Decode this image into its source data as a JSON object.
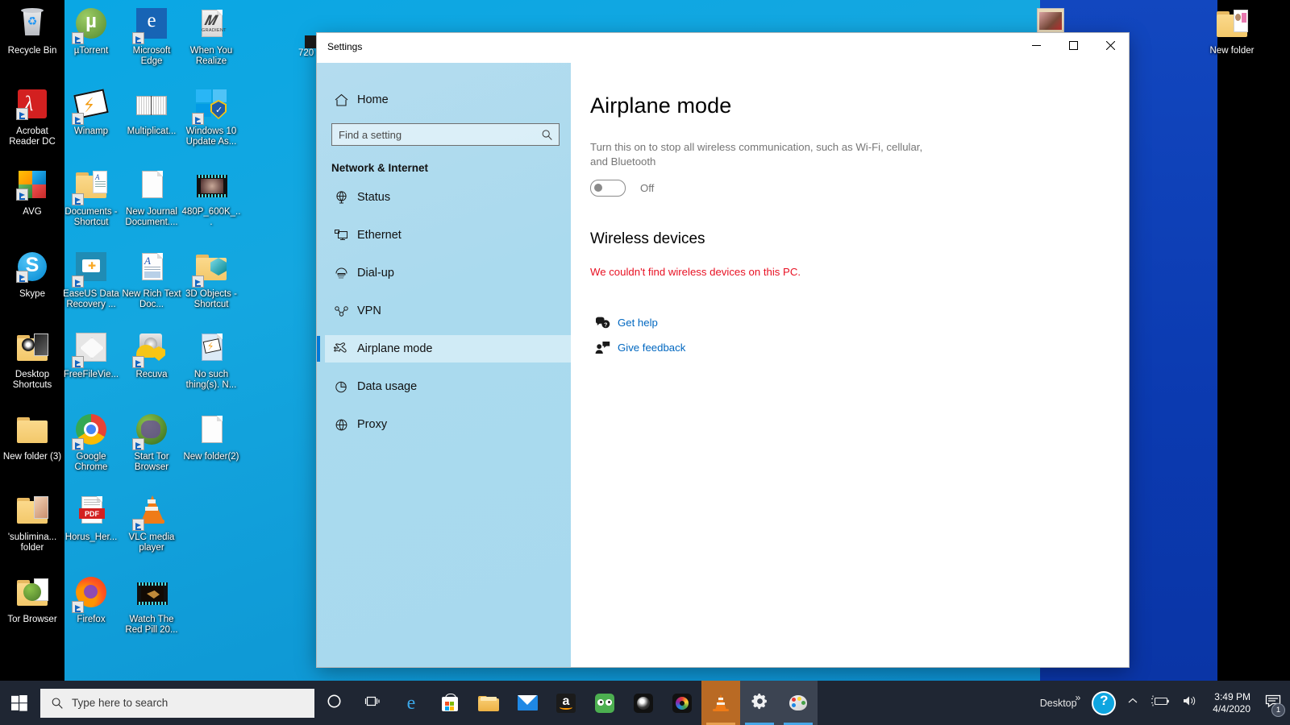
{
  "desktop": {
    "partial_label_720": "720",
    "column_left": [
      {
        "name": "Recycle Bin",
        "icon": "recycle-bin-icon"
      },
      {
        "name": "Acrobat Reader DC",
        "icon": "acrobat-reader-icon"
      },
      {
        "name": "AVG",
        "icon": "avg-icon"
      },
      {
        "name": "Skype",
        "icon": "skype-icon"
      },
      {
        "name": "Desktop Shortcuts",
        "icon": "folder-icon"
      },
      {
        "name": "New folder (3)",
        "icon": "folder-icon"
      },
      {
        "name": "'sublimina... folder",
        "icon": "folder-icon"
      },
      {
        "name": "Tor Browser",
        "icon": "folder-icon"
      }
    ],
    "grid": [
      {
        "name": "µTorrent",
        "icon": "utorrent-icon"
      },
      {
        "name": "Microsoft Edge",
        "icon": "edge-icon"
      },
      {
        "name": "When You Realize",
        "icon": "gradient-file-icon"
      },
      {
        "name": "Winamp",
        "icon": "winamp-icon"
      },
      {
        "name": "Multiplicat...",
        "icon": "image-file-icon"
      },
      {
        "name": "Windows 10 Update As...",
        "icon": "windows-update-icon"
      },
      {
        "name": "Documents - Shortcut",
        "icon": "documents-folder-icon"
      },
      {
        "name": "New Journal Document....",
        "icon": "document-icon"
      },
      {
        "name": "480P_600K_...",
        "icon": "video-file-icon"
      },
      {
        "name": "EaseUS Data Recovery ...",
        "icon": "easeus-icon"
      },
      {
        "name": "New Rich Text Doc...",
        "icon": "rtf-document-icon"
      },
      {
        "name": "3D Objects - Shortcut",
        "icon": "3d-objects-folder-icon"
      },
      {
        "name": "FreeFileVie...",
        "icon": "freefileviewer-icon"
      },
      {
        "name": "Recuva",
        "icon": "recuva-icon"
      },
      {
        "name": "No such thing(s). N...",
        "icon": "winamp-file-icon"
      },
      {
        "name": "Google Chrome",
        "icon": "chrome-icon"
      },
      {
        "name": "Start Tor Browser",
        "icon": "tor-icon"
      },
      {
        "name": "New folder(2)",
        "icon": "document-icon"
      },
      {
        "name": "Horus_Her...",
        "icon": "pdf-file-icon"
      },
      {
        "name": "VLC media player",
        "icon": "vlc-icon"
      },
      {
        "name": "",
        "icon": "none"
      },
      {
        "name": "Firefox",
        "icon": "firefox-icon"
      },
      {
        "name": "Watch The Red Pill 20...",
        "icon": "video-file-icon"
      },
      {
        "name": "",
        "icon": "none"
      }
    ],
    "right": [
      {
        "name": "New folder",
        "icon": "folder-icon"
      }
    ]
  },
  "window": {
    "title": "Settings",
    "controls": {
      "minimize": "minimize-button",
      "maximize": "maximize-button",
      "close": "close-button"
    }
  },
  "sidebar": {
    "home_label": "Home",
    "search": {
      "placeholder": "Find a setting",
      "value": ""
    },
    "category": "Network & Internet",
    "items": [
      {
        "label": "Status",
        "icon": "status-globe-icon",
        "selected": false
      },
      {
        "label": "Ethernet",
        "icon": "ethernet-icon",
        "selected": false
      },
      {
        "label": "Dial-up",
        "icon": "dialup-icon",
        "selected": false
      },
      {
        "label": "VPN",
        "icon": "vpn-icon",
        "selected": false
      },
      {
        "label": "Airplane mode",
        "icon": "airplane-icon",
        "selected": true
      },
      {
        "label": "Data usage",
        "icon": "data-usage-icon",
        "selected": false
      },
      {
        "label": "Proxy",
        "icon": "proxy-globe-icon",
        "selected": false
      }
    ]
  },
  "main": {
    "heading": "Airplane mode",
    "description": "Turn this on to stop all wireless communication, such as Wi-Fi, cellular, and Bluetooth",
    "toggle_state": "Off",
    "section_heading": "Wireless devices",
    "error_message": "We couldn't find wireless devices on this PC.",
    "links": [
      {
        "label": "Get help",
        "icon": "get-help-icon"
      },
      {
        "label": "Give feedback",
        "icon": "give-feedback-icon"
      }
    ]
  },
  "taskbar": {
    "start": "start-button",
    "search_placeholder": "Type here to search",
    "buttons": [
      {
        "name": "cortana-button",
        "icon": "cortana-circle-icon"
      },
      {
        "name": "task-view-button",
        "icon": "task-view-icon"
      },
      {
        "name": "edge-button",
        "icon": "edge-icon"
      },
      {
        "name": "microsoft-store-button",
        "icon": "store-icon"
      },
      {
        "name": "file-explorer-button",
        "icon": "folder-icon"
      },
      {
        "name": "mail-button",
        "icon": "mail-icon"
      },
      {
        "name": "amazon-button",
        "icon": "amazon-icon"
      },
      {
        "name": "tripadvisor-button",
        "icon": "tripadvisor-icon"
      },
      {
        "name": "media-app-button",
        "icon": "dark-lens-icon"
      },
      {
        "name": "color-lens-button",
        "icon": "color-lens-icon"
      },
      {
        "name": "vlc-button",
        "icon": "vlc-cone-icon"
      },
      {
        "name": "settings-button",
        "icon": "gear-icon"
      },
      {
        "name": "paint-button",
        "icon": "paint-palette-icon"
      }
    ],
    "tray": {
      "desktop_label": "Desktop",
      "overflow": "»",
      "help_icon": "help-question-icon",
      "chevron": "show-hidden-icons-chevron",
      "battery_icon": "battery-icon",
      "volume_icon": "volume-icon",
      "time": "3:49 PM",
      "date": "4/4/2020",
      "notification_count": "1"
    }
  },
  "colors": {
    "accent": "#0078d7",
    "link": "#0067c0",
    "error": "#e81123",
    "taskbar": "#1f2633",
    "sidebar": "#aadaee"
  }
}
